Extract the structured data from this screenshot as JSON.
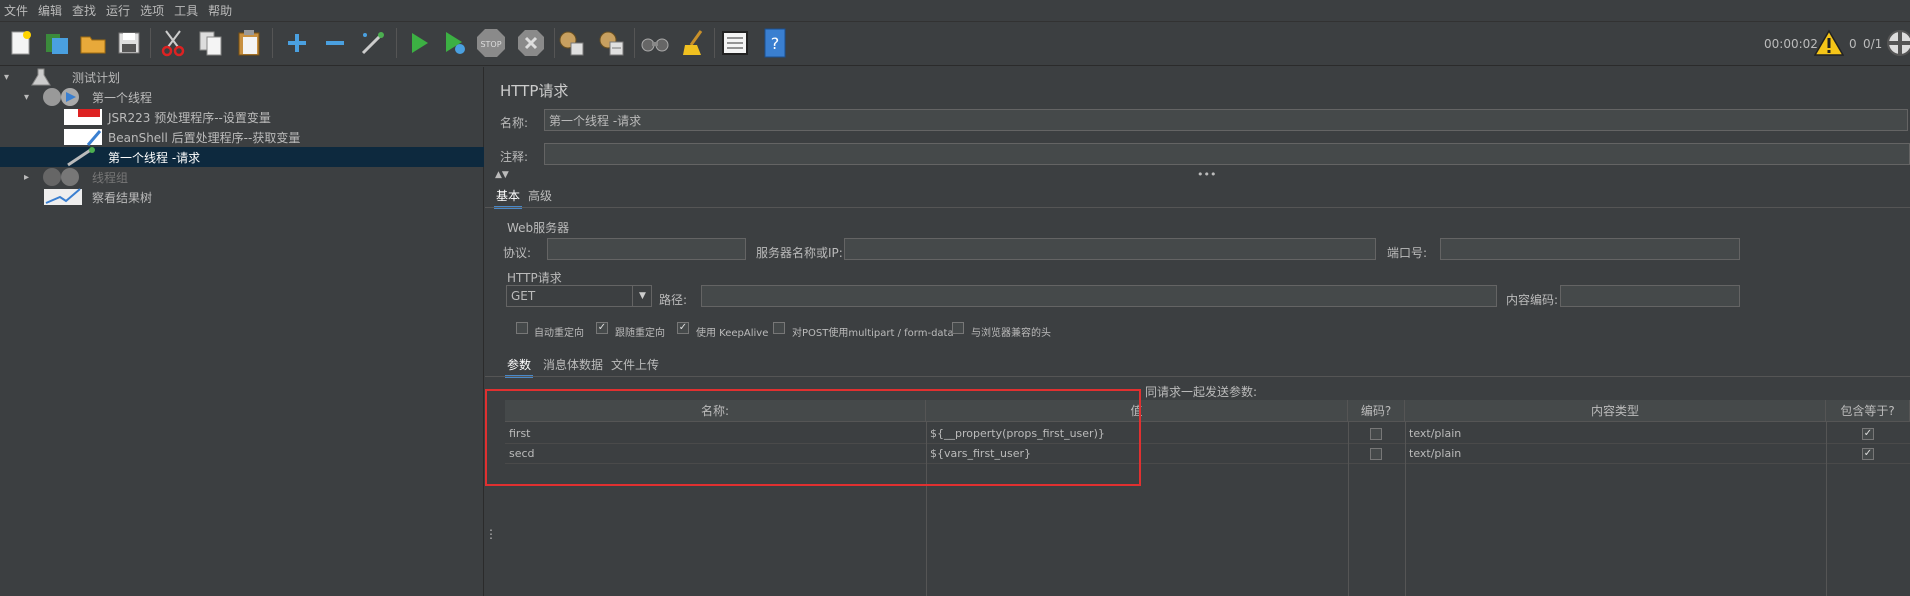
{
  "menu": [
    "文件",
    "编辑",
    "查找",
    "运行",
    "选项",
    "工具",
    "帮助"
  ],
  "toolbar": {
    "icons": [
      "new-icon",
      "templates-icon",
      "open-icon",
      "save-icon",
      "cut-icon",
      "copy-icon",
      "paste-icon",
      "expand-icon",
      "collapse-icon",
      "toggle-icon",
      "start-icon",
      "start-no-pause-icon",
      "stop-icon",
      "shutdown-icon",
      "clear-icon",
      "clear-all-icon",
      "search-icon",
      "reset-search-icon",
      "function-helper-icon",
      "help-icon"
    ],
    "timer": "00:00:02",
    "warnings": "0",
    "threads": "0/1"
  },
  "tree": {
    "nodes": [
      {
        "label": "测试计划"
      },
      {
        "label": "第一个线程"
      },
      {
        "label": "JSR223 预处理程序--设置变量"
      },
      {
        "label": "BeanShell 后置处理程序--获取变量"
      },
      {
        "label": "第一个线程 -请求"
      },
      {
        "label": "线程组"
      },
      {
        "label": "察看结果树"
      }
    ]
  },
  "panel": {
    "title": "HTTP请求",
    "name_label": "名称:",
    "name_value": "第一个线程 -请求",
    "comment_label": "注释:",
    "comment_value": "",
    "tabs": [
      "基本",
      "高级"
    ],
    "web_server_title": "Web服务器",
    "protocol_label": "协议:",
    "server_label": "服务器名称或IP:",
    "port_label": "端口号:",
    "http_title": "HTTP请求",
    "method": "GET",
    "path_label": "路径:",
    "encoding_label": "内容编码:",
    "options": [
      {
        "label": "自动重定向",
        "checked": false
      },
      {
        "label": "跟随重定向",
        "checked": true
      },
      {
        "label": "使用 KeepAlive",
        "checked": true
      },
      {
        "label": "对POST使用multipart / form-data",
        "checked": false
      },
      {
        "label": "与浏览器兼容的头",
        "checked": false
      }
    ],
    "subtabs": [
      "参数",
      "消息体数据",
      "文件上传"
    ],
    "send_params_label": "同请求一起发送参数:"
  },
  "table": {
    "columns": [
      "名称:",
      "值",
      "编码?",
      "内容类型",
      "包含等于?"
    ],
    "rows": [
      {
        "name": "first",
        "value": "${__property(props_first_user)}",
        "encode": false,
        "content_type": "text/plain",
        "include_equals": true
      },
      {
        "name": "secd",
        "value": "${vars_first_user}",
        "encode": false,
        "content_type": "text/plain",
        "include_equals": true
      }
    ]
  },
  "colors": {
    "background": "#3c3f41",
    "selection": "#0d293e",
    "highlight_box": "#e03030",
    "tab_underline": "#4a88c7"
  }
}
